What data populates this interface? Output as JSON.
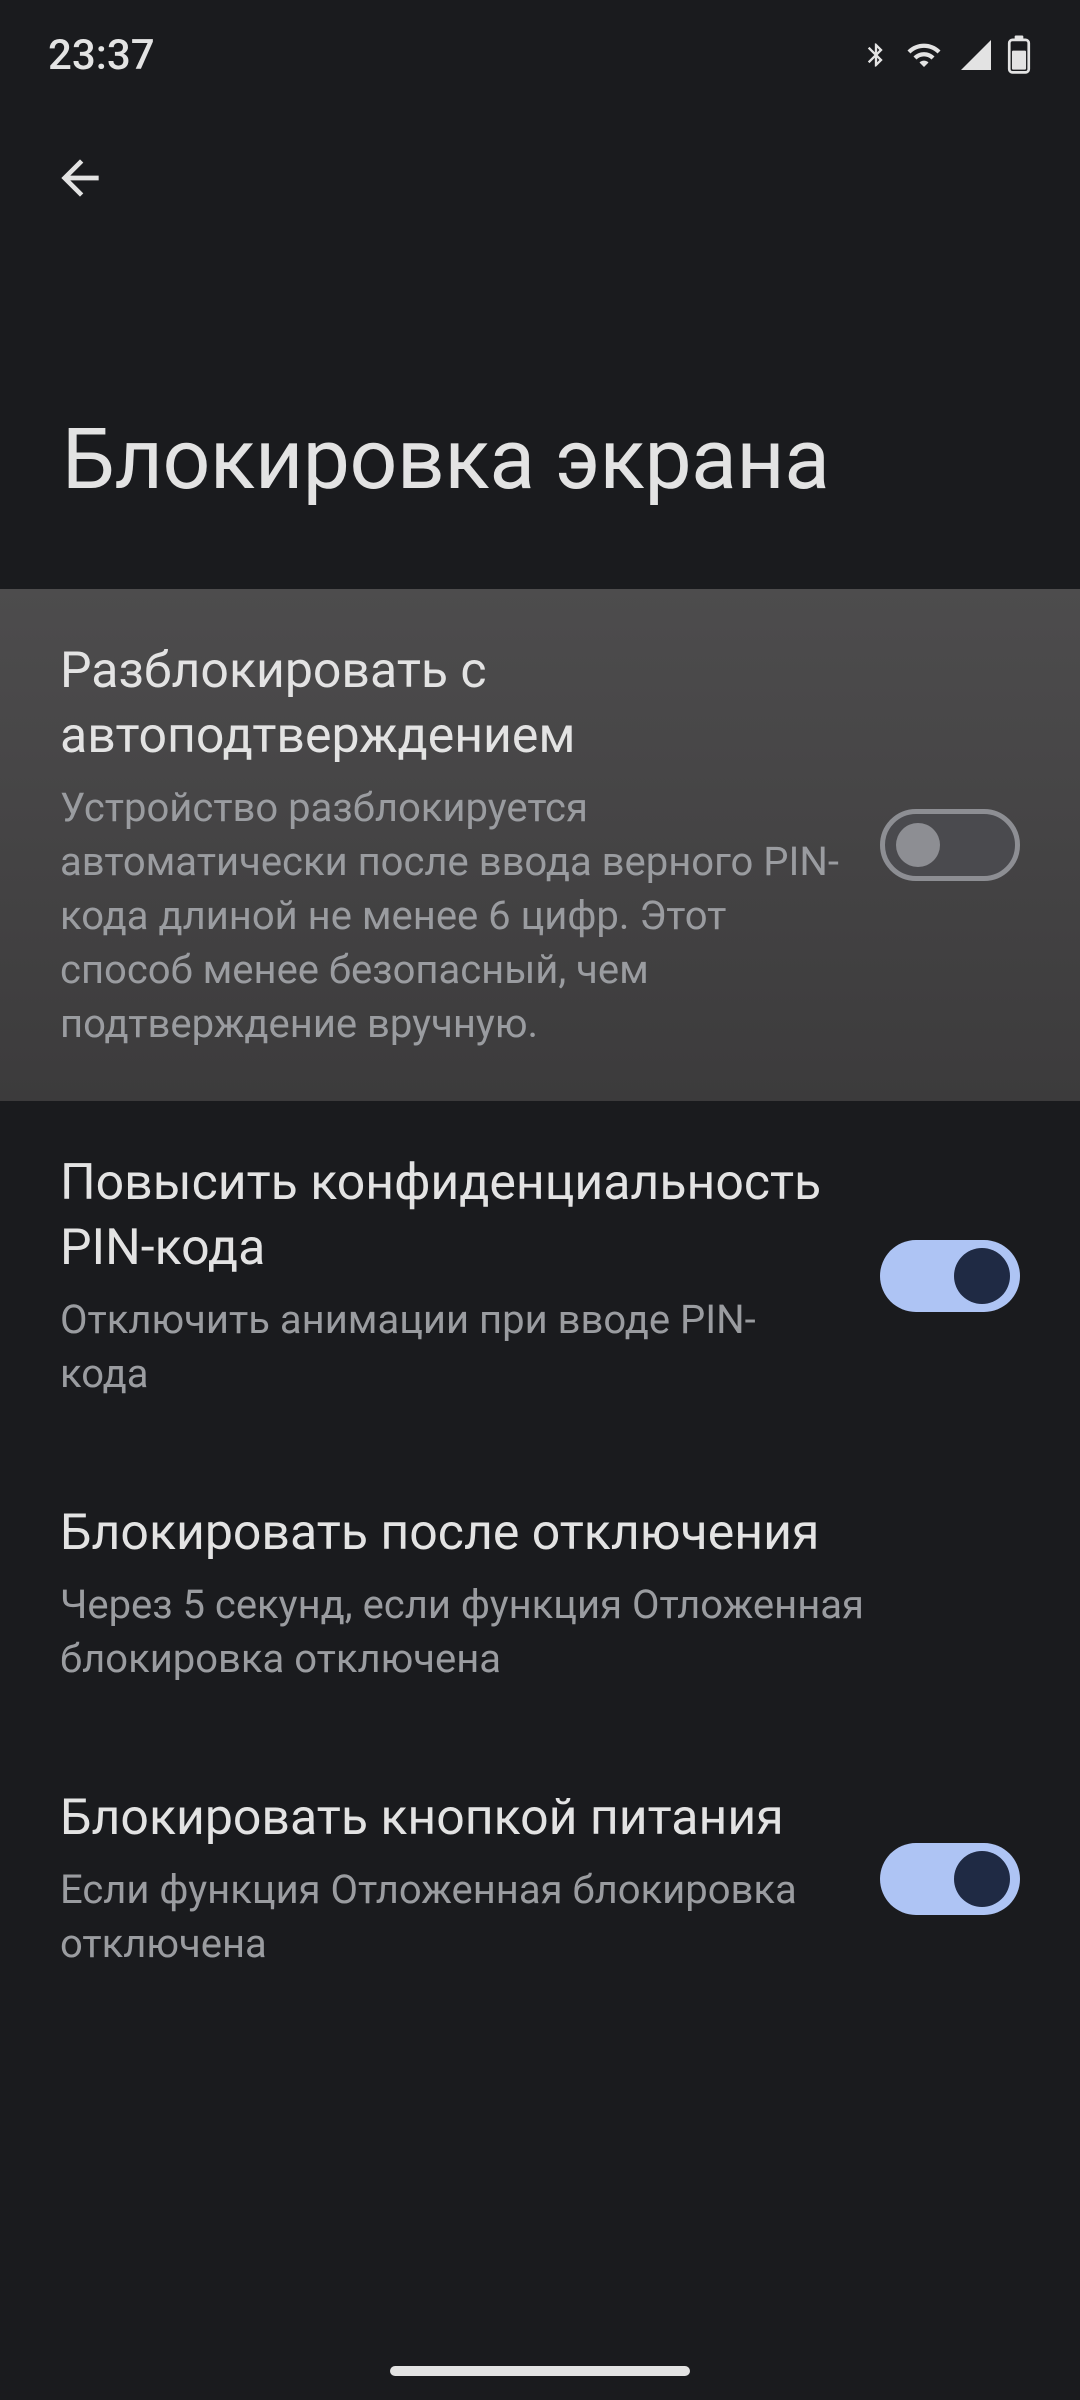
{
  "status": {
    "time": "23:37",
    "icons": [
      "bluetooth",
      "wifi",
      "cellular",
      "battery"
    ]
  },
  "page": {
    "title": "Блокировка экрана"
  },
  "settings": [
    {
      "key": "auto_confirm",
      "title": "Разблокировать с автоподтверждением",
      "subtitle": "Устройство разблокируется автоматически после ввода верного PIN-кода длиной не менее 6 цифр. Этот способ менее безопасный, чем подтверждение вручную.",
      "toggle": false,
      "highlighted": true,
      "hasToggle": true
    },
    {
      "key": "enhanced_privacy",
      "title": "Повысить конфиденциальность PIN-кода",
      "subtitle": "Отключить анимации при вводе PIN-кода",
      "toggle": true,
      "highlighted": false,
      "hasToggle": true
    },
    {
      "key": "lock_after",
      "title": "Блокировать после отключения",
      "subtitle": "Через 5 секунд, если функция Отложенная блокировка отключена",
      "toggle": null,
      "highlighted": false,
      "hasToggle": false
    },
    {
      "key": "power_button_lock",
      "title": "Блокировать кнопкой питания",
      "subtitle": "Если функция Отложенная блокировка отключена",
      "toggle": true,
      "highlighted": false,
      "hasToggle": true
    }
  ]
}
